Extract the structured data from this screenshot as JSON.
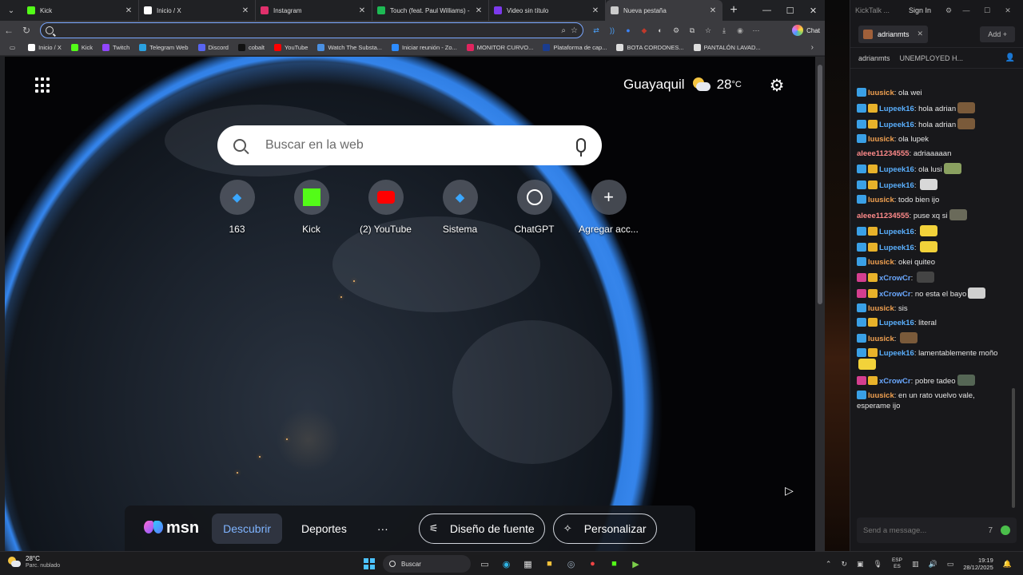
{
  "browser": {
    "tabs": [
      {
        "title": "Kick",
        "icon": "kick-icon",
        "color": "#53fc18",
        "active": false
      },
      {
        "title": "Inicio / X",
        "icon": "x-icon",
        "color": "#ffffff",
        "active": false
      },
      {
        "title": "Instagram",
        "icon": "instagram-icon",
        "color": "#e1306c",
        "active": false
      },
      {
        "title": "Touch (feat. Paul Williams) -",
        "icon": "spotify-icon",
        "color": "#1db954",
        "active": false
      },
      {
        "title": "Video sin título",
        "icon": "clipchamp-icon",
        "color": "#7c3aed",
        "active": false
      },
      {
        "title": "Nueva pestaña",
        "icon": "newtab-icon",
        "color": "#cccccc",
        "active": true
      }
    ],
    "omnibox_value": "",
    "chat_label": "Chat",
    "bookmarks": [
      {
        "label": "Inicio / X",
        "icon": "x-icon",
        "color": "#ffffff"
      },
      {
        "label": "Kick",
        "icon": "kick-icon",
        "color": "#53fc18"
      },
      {
        "label": "Twitch",
        "icon": "twitch-icon",
        "color": "#9146ff"
      },
      {
        "label": "Telegram Web",
        "icon": "telegram-icon",
        "color": "#2aa1e0"
      },
      {
        "label": "Discord",
        "icon": "discord-icon",
        "color": "#5865f2"
      },
      {
        "label": "cobalt",
        "icon": "cobalt-icon",
        "color": "#111111"
      },
      {
        "label": "YouTube",
        "icon": "youtube-icon",
        "color": "#ff0000"
      },
      {
        "label": "Watch The Substa...",
        "icon": "globe-icon",
        "color": "#4a90e2"
      },
      {
        "label": "Iniciar reunión - Zo...",
        "icon": "zoom-icon",
        "color": "#2d8cff"
      },
      {
        "label": "MONITOR CURVO...",
        "icon": "store-icon",
        "color": "#e0245e"
      },
      {
        "label": "Plataforma de cap...",
        "icon": "platform-icon",
        "color": "#1a3c8f"
      },
      {
        "label": "BOTA CORDONES...",
        "icon": "shop-icon",
        "color": "#dddddd"
      },
      {
        "label": "PANTALÓN LAVAD...",
        "icon": "shop-icon",
        "color": "#dddddd"
      }
    ]
  },
  "ntp": {
    "weather": {
      "city": "Guayaquil",
      "temp": "28",
      "unit": "°C"
    },
    "search_placeholder": "Buscar en la web",
    "tiles": [
      {
        "label": "163",
        "icon": "ug-icon",
        "color": "#3aa7ff"
      },
      {
        "label": "Kick",
        "icon": "kick-icon",
        "color": "#53fc18"
      },
      {
        "label": "(2) YouTube",
        "icon": "youtube-icon",
        "color": "#ff0000"
      },
      {
        "label": "Sistema",
        "icon": "ug-icon",
        "color": "#3aa7ff"
      },
      {
        "label": "ChatGPT",
        "icon": "chatgpt-icon",
        "color": "#ffffff"
      },
      {
        "label": "Agregar acc...",
        "icon": "plus-icon",
        "color": "#ffffff"
      }
    ],
    "msn": {
      "logo": "msn",
      "discover": "Descubrir",
      "sports": "Deportes",
      "more": "···",
      "font_design": "Diseño de fuente",
      "customize": "Personalizar"
    }
  },
  "kick": {
    "app_title": "KickTalk ...",
    "sign_in": "Sign In",
    "tab_user": "adrianmts",
    "add_label": "Add",
    "channel": "adrianmts",
    "stream_title": "UNEMPLOYED H...",
    "input_placeholder": "Send a message...",
    "messages": [
      {
        "user": "luusick",
        "ucolor": "#f0a050",
        "badges": [
          "blue"
        ],
        "text": "ola wei",
        "emote": ""
      },
      {
        "user": "Lupeek16",
        "ucolor": "#5ab0ff",
        "badges": [
          "blue",
          "gold"
        ],
        "text": "hola adrian",
        "emote": "#7a5a3a"
      },
      {
        "user": "Lupeek16",
        "ucolor": "#5ab0ff",
        "badges": [
          "blue",
          "gold"
        ],
        "text": "hola adrian",
        "emote": "#7a5a3a"
      },
      {
        "user": "luusick",
        "ucolor": "#f0a050",
        "badges": [
          "blue"
        ],
        "text": "ola lupek",
        "emote": ""
      },
      {
        "user": "aleee11234555",
        "ucolor": "#ff8a8a",
        "badges": [],
        "text": "adriaaaaan",
        "emote": ""
      },
      {
        "user": "Lupeek16",
        "ucolor": "#5ab0ff",
        "badges": [
          "blue",
          "gold"
        ],
        "text": "ola lusi",
        "emote": "#8aa060"
      },
      {
        "user": "Lupeek16",
        "ucolor": "#5ab0ff",
        "badges": [
          "blue",
          "gold"
        ],
        "text": "",
        "emote": "#d8d8d8"
      },
      {
        "user": "luusick",
        "ucolor": "#f0a050",
        "badges": [
          "blue"
        ],
        "text": "todo bien ijo",
        "emote": ""
      },
      {
        "user": "aleee11234555",
        "ucolor": "#ff8a8a",
        "badges": [],
        "text": "puse xq si",
        "emote": "#6a6a5a"
      },
      {
        "user": "Lupeek16",
        "ucolor": "#5ab0ff",
        "badges": [
          "blue",
          "gold"
        ],
        "text": "",
        "emote": "#f2d23a"
      },
      {
        "user": "Lupeek16",
        "ucolor": "#5ab0ff",
        "badges": [
          "blue",
          "gold"
        ],
        "text": "",
        "emote": "#f2d23a"
      },
      {
        "user": "luusick",
        "ucolor": "#f0a050",
        "badges": [
          "blue"
        ],
        "text": "okei quiteo",
        "emote": ""
      },
      {
        "user": "xCrowCr",
        "ucolor": "#6aa8ff",
        "badges": [
          "pink",
          "gold"
        ],
        "text": "",
        "emote": "#444444"
      },
      {
        "user": "xCrowCr",
        "ucolor": "#6aa8ff",
        "badges": [
          "pink",
          "gold"
        ],
        "text": "no esta el bayo",
        "emote": "#cfcfcf"
      },
      {
        "user": "luusick",
        "ucolor": "#f0a050",
        "badges": [
          "blue"
        ],
        "text": "sis",
        "emote": ""
      },
      {
        "user": "Lupeek16",
        "ucolor": "#5ab0ff",
        "badges": [
          "blue",
          "gold"
        ],
        "text": "literal",
        "emote": ""
      },
      {
        "user": "luusick",
        "ucolor": "#f0a050",
        "badges": [
          "blue"
        ],
        "text": "",
        "emote": "#7a5a3a"
      },
      {
        "user": "Lupeek16",
        "ucolor": "#5ab0ff",
        "badges": [
          "blue",
          "gold"
        ],
        "text": "lamentablemente moño",
        "emote": "#f2d23a"
      },
      {
        "user": "xCrowCr",
        "ucolor": "#6aa8ff",
        "badges": [
          "pink",
          "gold"
        ],
        "text": "pobre tadeo",
        "emote": "#556655"
      },
      {
        "user": "luusick",
        "ucolor": "#f0a050",
        "badges": [
          "blue"
        ],
        "text": "en un rato vuelvo vale, esperame ijo",
        "emote": ""
      }
    ]
  },
  "taskbar": {
    "temp": "28°C",
    "condition": "Parc. nublado",
    "search_label": "Buscar",
    "lang_top": "ESP",
    "lang_bottom": "ES",
    "time": "19:19",
    "date": "28/12/2025"
  }
}
